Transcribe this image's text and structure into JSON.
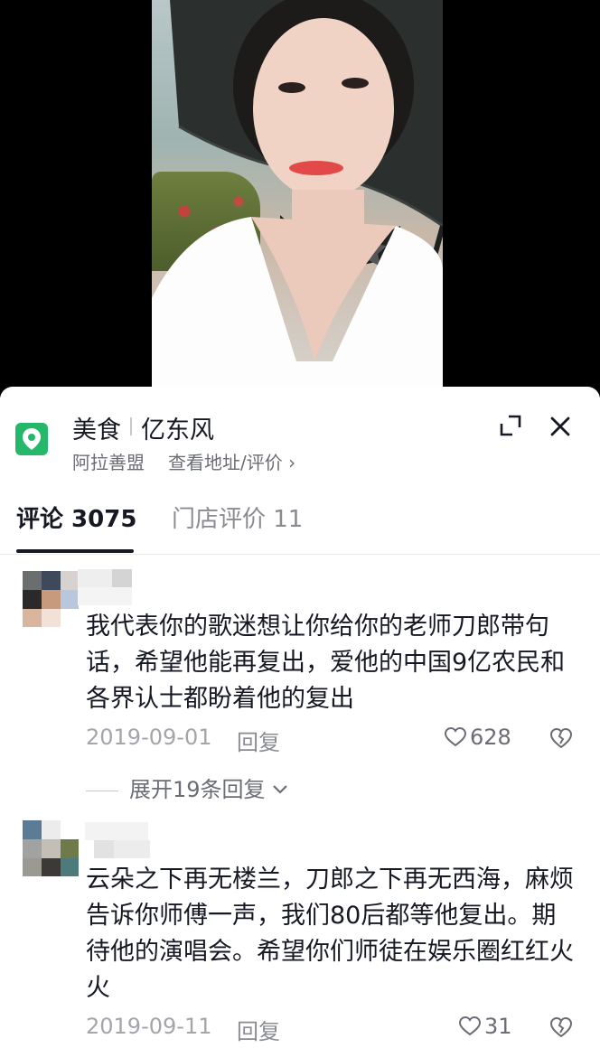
{
  "poi": {
    "category": "美食",
    "name": "亿东风",
    "region": "阿拉善盟",
    "address_link": "查看地址/评价",
    "link_arrow": "›"
  },
  "tabs": [
    {
      "label": "评论 3075",
      "active": true
    },
    {
      "label": "门店评价 11",
      "active": false
    }
  ],
  "comments": [
    {
      "text": "我代表你的歌迷想让你给你的老师刀郎带句话，希望他能再复出，爱他的中国9亿农民和各界认士都盼着他的复出",
      "date": "2019-09-01",
      "reply_label": "回复",
      "likes": "628",
      "expand_label": "展开19条回复"
    },
    {
      "text": "云朵之下再无楼兰，刀郎之下再无西海，麻烦告诉你师傅一声，我们80后都等他复出。期待他的演唱会。希望你们师徒在娱乐圈红红火火",
      "date": "2019-09-11",
      "reply_label": "回复",
      "likes": "31"
    }
  ],
  "icons": {
    "poi": "location-pin-icon",
    "expand": "expand-icon",
    "close": "close-icon",
    "like": "heart-icon",
    "dislike": "broken-heart-icon",
    "chevron": "chevron-down-icon"
  },
  "colors": {
    "poi_green": "#25b86a",
    "text_primary": "#161823",
    "text_secondary": "#a4a5aa"
  }
}
